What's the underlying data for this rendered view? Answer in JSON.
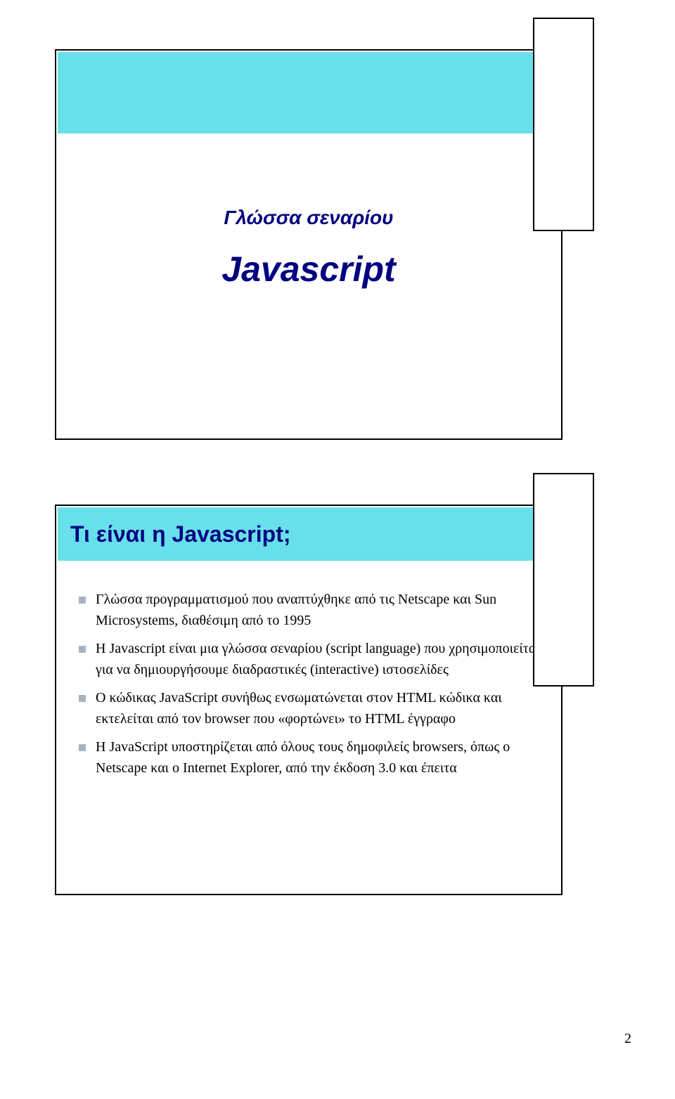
{
  "slide1": {
    "title_bar": "",
    "overline": "Γλώσσα σεναρίου",
    "heading": "Javascript"
  },
  "slide2": {
    "title_bar": "Τι είναι η Javascript;",
    "bullets": [
      "Γλώσσα προγραμματισμού που αναπτύχθηκε από τις Netscape και Sun Microsystems, διαθέσιμη από το 1995",
      "Η Javascript είναι μια γλώσσα σεναρίου (script language) που χρησιμοποιείται για να δημιουργήσουμε διαδραστικές (interactive) ιστοσελίδες",
      "Ο κώδικας JavaScript συνήθως ενσωματώνεται στον HTML κώδικα και εκτελείται από τον browser που «φορτώνει» το HTML έγγραφο",
      "Η JavaScript υποστηρίζεται από όλους τους δημοφιλείς browsers, όπως ο Netscape και ο Internet Explorer, από την έκδοση 3.0 και έπειτα"
    ]
  },
  "page_number": "2"
}
